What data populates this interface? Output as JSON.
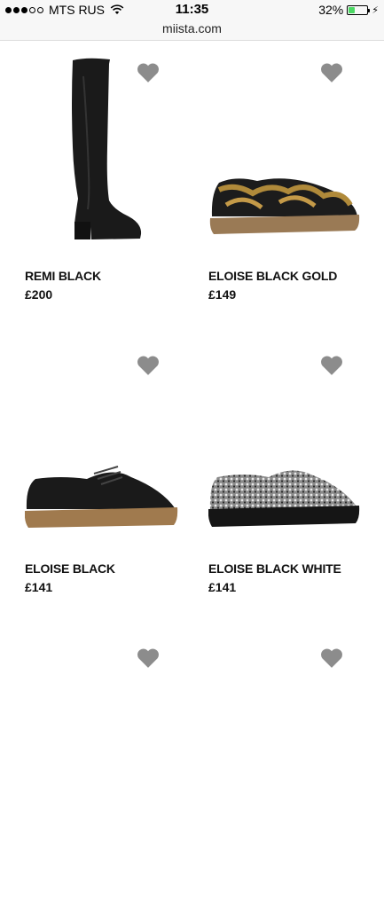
{
  "status": {
    "signal_dots": [
      true,
      true,
      true,
      false,
      false
    ],
    "carrier": "MTS RUS",
    "time": "11:35",
    "battery": "32%",
    "battery_level": 0.32
  },
  "browser": {
    "url": "miista.com"
  },
  "products": [
    {
      "name": "REMI BLACK",
      "price": "£200",
      "image": "boot-black"
    },
    {
      "name": "ELOISE BLACK GOLD",
      "price": "£149",
      "image": "shoe-black-gold"
    },
    {
      "name": "ELOISE BLACK",
      "price": "£141",
      "image": "shoe-black"
    },
    {
      "name": "ELOISE BLACK WHITE",
      "price": "£141",
      "image": "shoe-black-white"
    },
    {
      "name": "",
      "price": "",
      "image": ""
    },
    {
      "name": "",
      "price": "",
      "image": ""
    }
  ],
  "icons": {
    "favorite": "heart-icon"
  },
  "colors": {
    "heart": "#8c8c8c",
    "battery": "#4cd964"
  }
}
